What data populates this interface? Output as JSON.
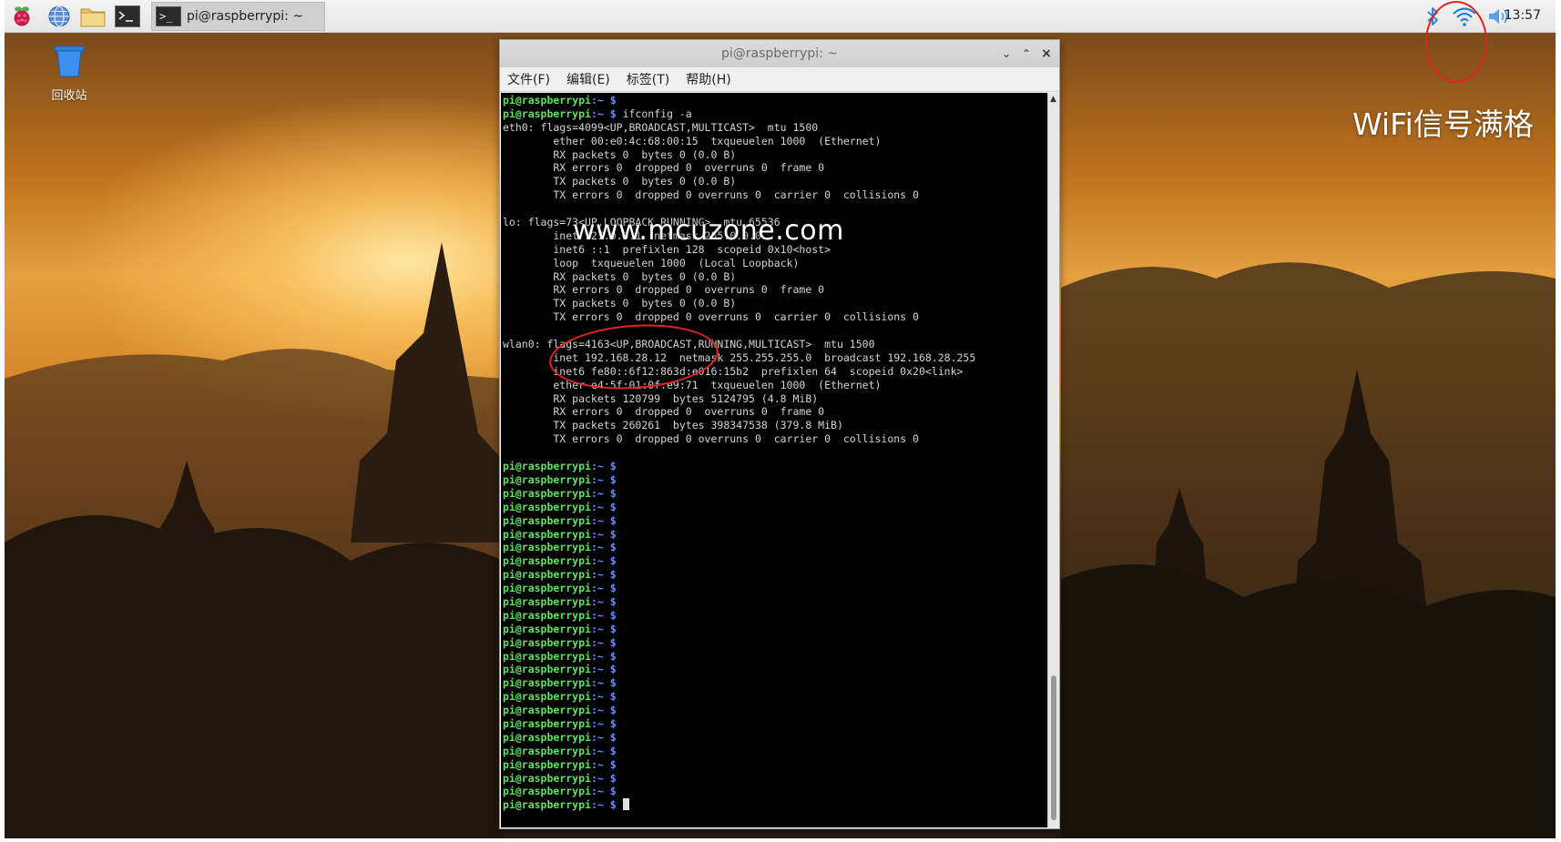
{
  "taskbar": {
    "icons": [
      "raspberry-pi-menu-icon",
      "web-browser-icon",
      "file-manager-icon",
      "terminal-icon"
    ],
    "task_label": "pi@raspberrypi: ~",
    "tray_icons": [
      "bluetooth-icon",
      "wifi-icon",
      "volume-icon"
    ],
    "clock": "13:57"
  },
  "desktop": {
    "trash_label": "回收站",
    "watermark": "www.mcuzone.com",
    "annotation": "WiFi信号满格"
  },
  "terminal": {
    "title": "pi@raspberrypi: ~",
    "menu": [
      "文件(F)",
      "编辑(E)",
      "标签(T)",
      "帮助(H)"
    ],
    "prompt_user": "pi@raspberrypi",
    "prompt_path": ":~ $",
    "lines": [
      {
        "p": true,
        "t": ""
      },
      {
        "p": true,
        "t": " ifconfig -a"
      },
      {
        "p": false,
        "t": "eth0: flags=4099<UP,BROADCAST,MULTICAST>  mtu 1500"
      },
      {
        "p": false,
        "t": "        ether 00:e0:4c:68:00:15  txqueuelen 1000  (Ethernet)"
      },
      {
        "p": false,
        "t": "        RX packets 0  bytes 0 (0.0 B)"
      },
      {
        "p": false,
        "t": "        RX errors 0  dropped 0  overruns 0  frame 0"
      },
      {
        "p": false,
        "t": "        TX packets 0  bytes 0 (0.0 B)"
      },
      {
        "p": false,
        "t": "        TX errors 0  dropped 0 overruns 0  carrier 0  collisions 0"
      },
      {
        "p": false,
        "t": ""
      },
      {
        "p": false,
        "t": "lo: flags=73<UP,LOOPBACK,RUNNING>  mtu 65536"
      },
      {
        "p": false,
        "t": "        inet 127.0.0.1  netmask 255.0.0.0"
      },
      {
        "p": false,
        "t": "        inet6 ::1  prefixlen 128  scopeid 0x10<host>"
      },
      {
        "p": false,
        "t": "        loop  txqueuelen 1000  (Local Loopback)"
      },
      {
        "p": false,
        "t": "        RX packets 0  bytes 0 (0.0 B)"
      },
      {
        "p": false,
        "t": "        RX errors 0  dropped 0  overruns 0  frame 0"
      },
      {
        "p": false,
        "t": "        TX packets 0  bytes 0 (0.0 B)"
      },
      {
        "p": false,
        "t": "        TX errors 0  dropped 0 overruns 0  carrier 0  collisions 0"
      },
      {
        "p": false,
        "t": ""
      },
      {
        "p": false,
        "t": "wlan0: flags=4163<UP,BROADCAST,RUNNING,MULTICAST>  mtu 1500"
      },
      {
        "p": false,
        "t": "        inet 192.168.28.12  netmask 255.255.255.0  broadcast 192.168.28.255"
      },
      {
        "p": false,
        "t": "        inet6 fe80::6f12:863d:e016:15b2  prefixlen 64  scopeid 0x20<link>"
      },
      {
        "p": false,
        "t": "        ether e4:5f:01:0f:e9:71  txqueuelen 1000  (Ethernet)"
      },
      {
        "p": false,
        "t": "        RX packets 120799  bytes 5124795 (4.8 MiB)"
      },
      {
        "p": false,
        "t": "        RX errors 0  dropped 0  overruns 0  frame 0"
      },
      {
        "p": false,
        "t": "        TX packets 260261  bytes 398347538 (379.8 MiB)"
      },
      {
        "p": false,
        "t": "        TX errors 0  dropped 0 overruns 0  carrier 0  collisions 0"
      },
      {
        "p": false,
        "t": ""
      },
      {
        "p": true,
        "t": ""
      },
      {
        "p": true,
        "t": ""
      },
      {
        "p": true,
        "t": ""
      },
      {
        "p": true,
        "t": ""
      },
      {
        "p": true,
        "t": ""
      },
      {
        "p": true,
        "t": ""
      },
      {
        "p": true,
        "t": ""
      },
      {
        "p": true,
        "t": ""
      },
      {
        "p": true,
        "t": ""
      },
      {
        "p": true,
        "t": ""
      },
      {
        "p": true,
        "t": ""
      },
      {
        "p": true,
        "t": ""
      },
      {
        "p": true,
        "t": ""
      },
      {
        "p": true,
        "t": ""
      },
      {
        "p": true,
        "t": ""
      },
      {
        "p": true,
        "t": ""
      },
      {
        "p": true,
        "t": ""
      },
      {
        "p": true,
        "t": ""
      },
      {
        "p": true,
        "t": ""
      },
      {
        "p": true,
        "t": ""
      },
      {
        "p": true,
        "t": ""
      },
      {
        "p": true,
        "t": ""
      },
      {
        "p": true,
        "t": ""
      },
      {
        "p": true,
        "t": ""
      },
      {
        "p": true,
        "t": ""
      },
      {
        "p": true,
        "t": "",
        "cursor": true
      }
    ]
  },
  "colors": {
    "prompt_user": "#5ee35e",
    "prompt_path": "#6d8cff",
    "terminal_text": "#d3d3d3",
    "annotation_ellipse": "#e02424",
    "wifi_icon": "#1e7fd8"
  }
}
